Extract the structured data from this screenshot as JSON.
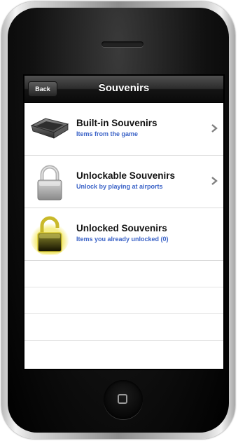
{
  "navbar": {
    "back_label": "Back",
    "title": "Souvenirs"
  },
  "rows": [
    {
      "title": "Built-in Souvenirs",
      "subtitle": "Items from the game",
      "icon": "tray-icon",
      "has_chevron": true
    },
    {
      "title": "Unlockable Souvenirs",
      "subtitle": "Unlock by playing at airports",
      "icon": "padlock-locked-icon",
      "has_chevron": true
    },
    {
      "title": "Unlocked Souvenirs",
      "subtitle": "Items you already unlocked (0)",
      "icon": "padlock-unlocked-icon",
      "has_chevron": false
    }
  ],
  "colors": {
    "subtitle": "#3b63c7",
    "navbar": "#1a1a1a",
    "unlocked_glow": "#f6f07a"
  }
}
